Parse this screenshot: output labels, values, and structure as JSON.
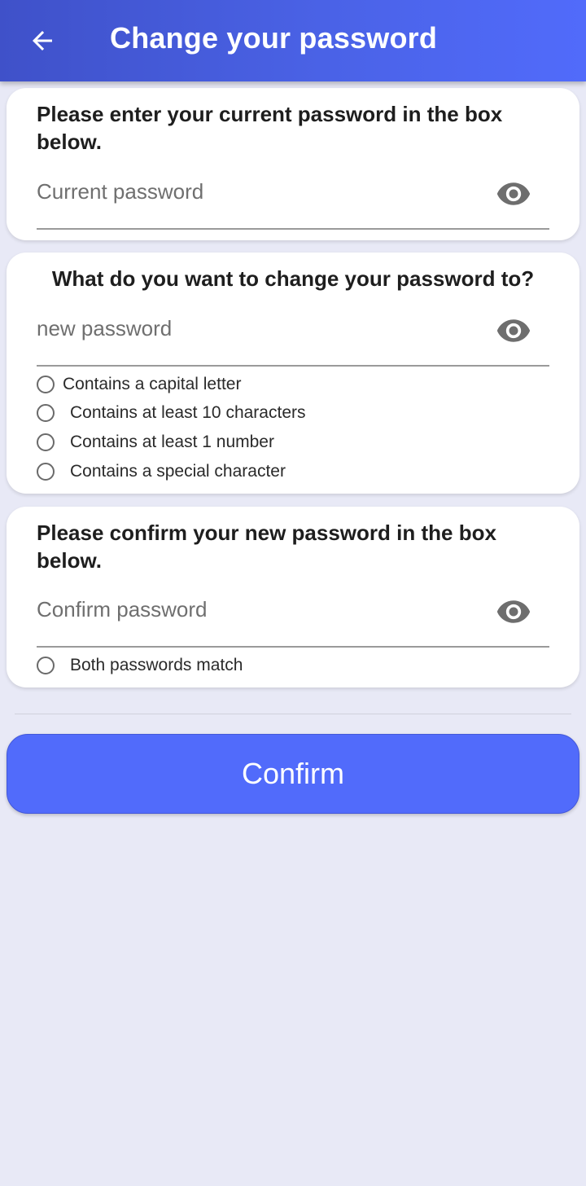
{
  "appbar": {
    "title": "Change your password",
    "back_icon": "arrow-left-icon"
  },
  "current_card": {
    "heading": "Please enter your current password in the box below.",
    "placeholder": "Current password",
    "value": "",
    "eye_icon": "eye-icon"
  },
  "new_card": {
    "heading": "What do you want to change your password to?",
    "placeholder": "new password",
    "value": "",
    "eye_icon": "eye-icon",
    "requirements": [
      {
        "label": "Contains a capital letter",
        "checked": false
      },
      {
        "label": "Contains at least 10 characters",
        "checked": false
      },
      {
        "label": "Contains at least 1 number",
        "checked": false
      },
      {
        "label": "Contains a special character",
        "checked": false
      }
    ]
  },
  "confirm_card": {
    "heading": "Please confirm your new password in the box below.",
    "placeholder": "Confirm password",
    "value": "",
    "eye_icon": "eye-icon",
    "match": {
      "label": "Both passwords match",
      "checked": false
    }
  },
  "confirm_button": {
    "label": "Confirm"
  },
  "colors": {
    "primary": "#516bfb",
    "appbar_start": "#3f51c9",
    "background": "#e8e9f6"
  }
}
